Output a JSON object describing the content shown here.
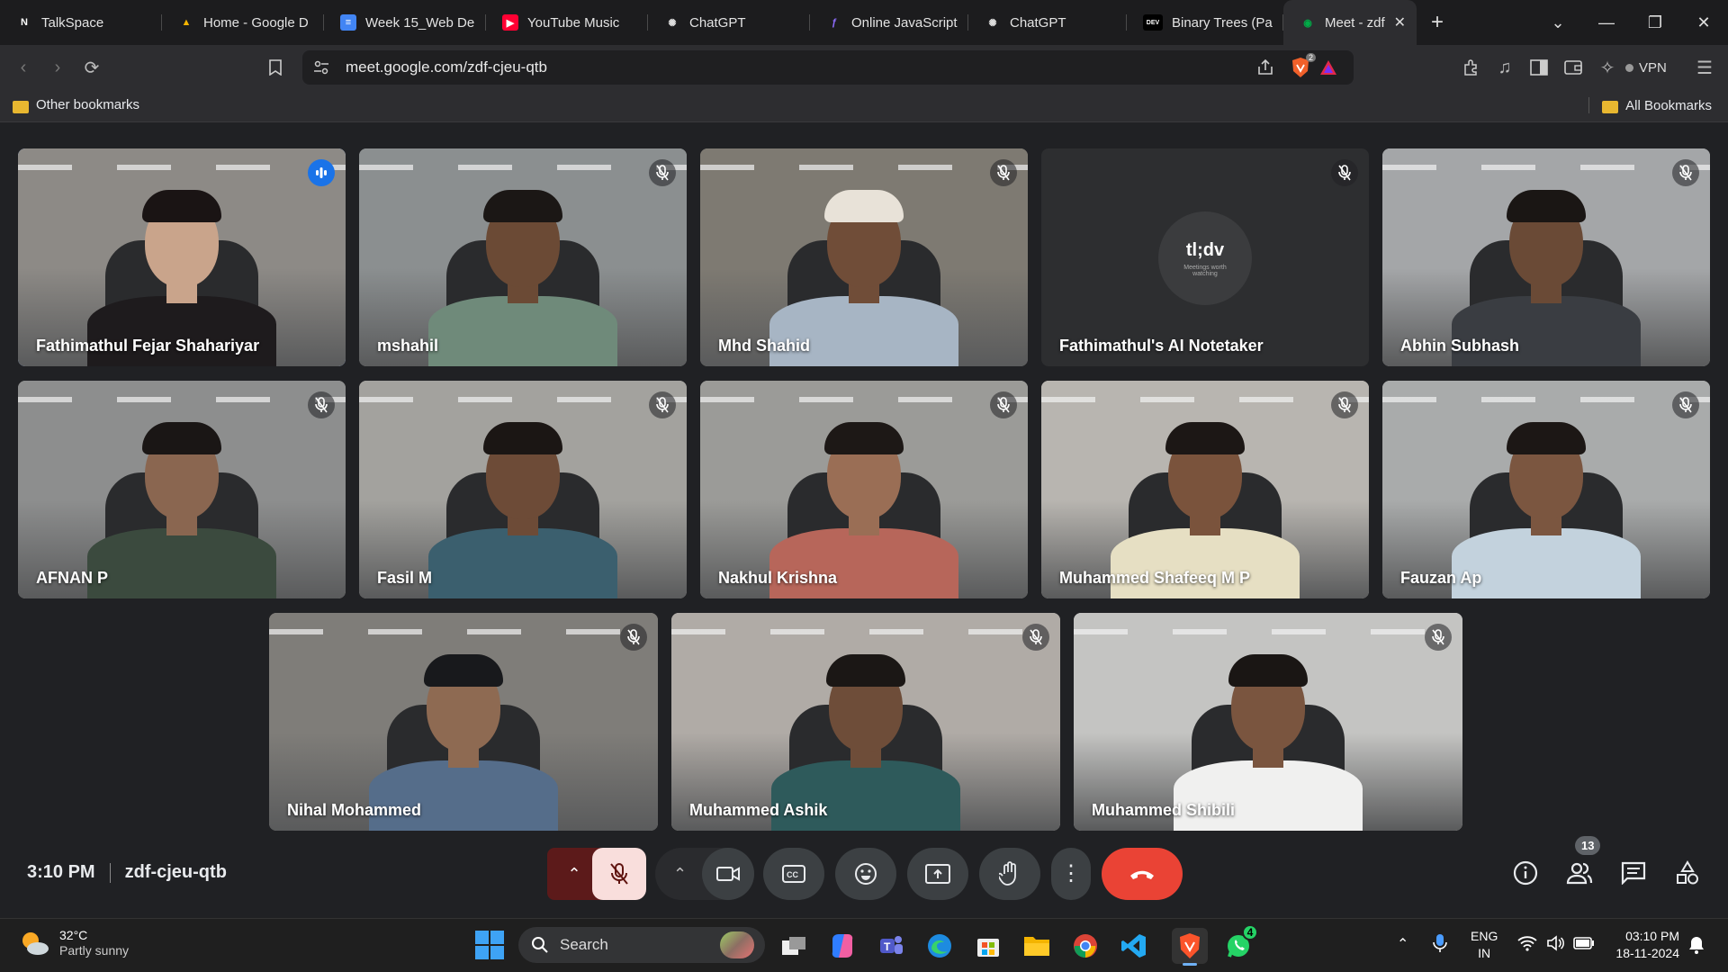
{
  "browser": {
    "tabs": [
      {
        "title": "TalkSpace",
        "favicon": "notion-icon",
        "fav_glyph": "N",
        "fav_color": "#ffffff",
        "fav_bg": "#1c1c1e"
      },
      {
        "title": "Home - Google D",
        "favicon": "google-drive-icon",
        "fav_glyph": "▲",
        "fav_color": "#f4b400",
        "fav_bg": "transparent"
      },
      {
        "title": "Week 15_Web De",
        "favicon": "google-docs-icon",
        "fav_glyph": "≡",
        "fav_color": "#ffffff",
        "fav_bg": "#4285f4"
      },
      {
        "title": "YouTube Music",
        "favicon": "youtube-music-icon",
        "fav_glyph": "▶",
        "fav_color": "#ffffff",
        "fav_bg": "#ff0033"
      },
      {
        "title": "ChatGPT",
        "favicon": "chatgpt-icon",
        "fav_glyph": "✺",
        "fav_color": "#dddddd",
        "fav_bg": "transparent"
      },
      {
        "title": "Online JavaScript",
        "favicon": "javascript-icon",
        "fav_glyph": "ƒ",
        "fav_color": "#8e6cff",
        "fav_bg": "transparent"
      },
      {
        "title": "ChatGPT",
        "favicon": "chatgpt-icon",
        "fav_glyph": "✺",
        "fav_color": "#dddddd",
        "fav_bg": "transparent"
      },
      {
        "title": "Binary Trees (Part",
        "favicon": "dev-icon",
        "fav_glyph": "DEV",
        "fav_color": "#ffffff",
        "fav_bg": "#000000"
      },
      {
        "title": "Meet - zdf",
        "favicon": "google-meet-icon",
        "fav_glyph": "◉",
        "fav_color": "#00ac47",
        "fav_bg": "transparent",
        "active": true
      }
    ],
    "new_tab": "+",
    "url": "meet.google.com/zdf-cjeu-qtb",
    "vpn_label": "VPN",
    "brave_badge": "2",
    "bookmarks": {
      "left": "Other bookmarks",
      "right": "All Bookmarks"
    }
  },
  "meet": {
    "participants": [
      {
        "name": "Fathimathul Fejar Shahariyar",
        "speaking": true,
        "bg": "#8d8a86",
        "skin": "#c9a48b",
        "shirt": "#1e1b1d",
        "hair": "#1a1414"
      },
      {
        "name": "mshahil",
        "muted": true,
        "bg": "#8b8f90",
        "skin": "#6b4a35",
        "shirt": "#6f8a7a",
        "hair": "#1b1715"
      },
      {
        "name": "Mhd Shahid",
        "muted": true,
        "bg": "#7e7a72",
        "skin": "#704d38",
        "shirt": "#a7b5c4",
        "hair": "#e8e2d8"
      },
      {
        "name": "Fathimathul's AI Notetaker",
        "muted": true,
        "bg": "#2d2e30",
        "notetaker": true,
        "logo": "tl;dv",
        "tagline": "Meetings worth watching"
      },
      {
        "name": "Abhin Subhash",
        "muted": true,
        "bg": "#a4a6a8",
        "skin": "#6a4a36",
        "shirt": "#3a3d42",
        "hair": "#1a1614"
      },
      {
        "name": "AFNAN P",
        "muted": true,
        "bg": "#8d8e8e",
        "skin": "#8a6650",
        "shirt": "#3b4a3e",
        "hair": "#1a1615"
      },
      {
        "name": "Fasil M",
        "muted": true,
        "bg": "#a3a29e",
        "skin": "#6d4b37",
        "shirt": "#3b5f6e",
        "hair": "#1b1614"
      },
      {
        "name": "Nakhul Krishna",
        "muted": true,
        "bg": "#9b9b98",
        "skin": "#9a6e55",
        "shirt": "#b7665a",
        "hair": "#1d1816"
      },
      {
        "name": "Muhammed Shafeeq M P",
        "muted": true,
        "bg": "#b8b5b0",
        "skin": "#7a533c",
        "shirt": "#e6dfc3",
        "hair": "#1c1715"
      },
      {
        "name": "Fauzan Ap",
        "muted": true,
        "bg": "#a9abab",
        "skin": "#7b5640",
        "shirt": "#c3d2dd",
        "hair": "#1c1715"
      },
      {
        "name": "Nihal Mohammed",
        "muted": true,
        "bg": "#7f7d79",
        "skin": "#8e6a52",
        "shirt": "#556d8a",
        "hair": "#18191c"
      },
      {
        "name": "Muhammed Ashik",
        "muted": true,
        "bg": "#b0aba6",
        "skin": "#6e4d39",
        "shirt": "#2e5a5b",
        "hair": "#1b1715"
      },
      {
        "name": "Muhammed Shibili",
        "muted": true,
        "bg": "#c4c4c2",
        "skin": "#7a553f",
        "shirt": "#f0f0ef",
        "hair": "#1a1614"
      }
    ],
    "time": "3:10 PM",
    "meeting_code": "zdf-cjeu-qtb",
    "people_count": "13"
  },
  "taskbar": {
    "weather_temp": "32°C",
    "weather_desc": "Partly sunny",
    "search_placeholder": "Search",
    "lang_top": "ENG",
    "lang_bottom": "IN",
    "clock_time": "03:10 PM",
    "clock_date": "18-11-2024",
    "whatsapp_badge": "4"
  },
  "colors": {
    "accent": "#8ab4f8",
    "end_call": "#ea4335",
    "mic_off_bg": "#f9dedc"
  }
}
